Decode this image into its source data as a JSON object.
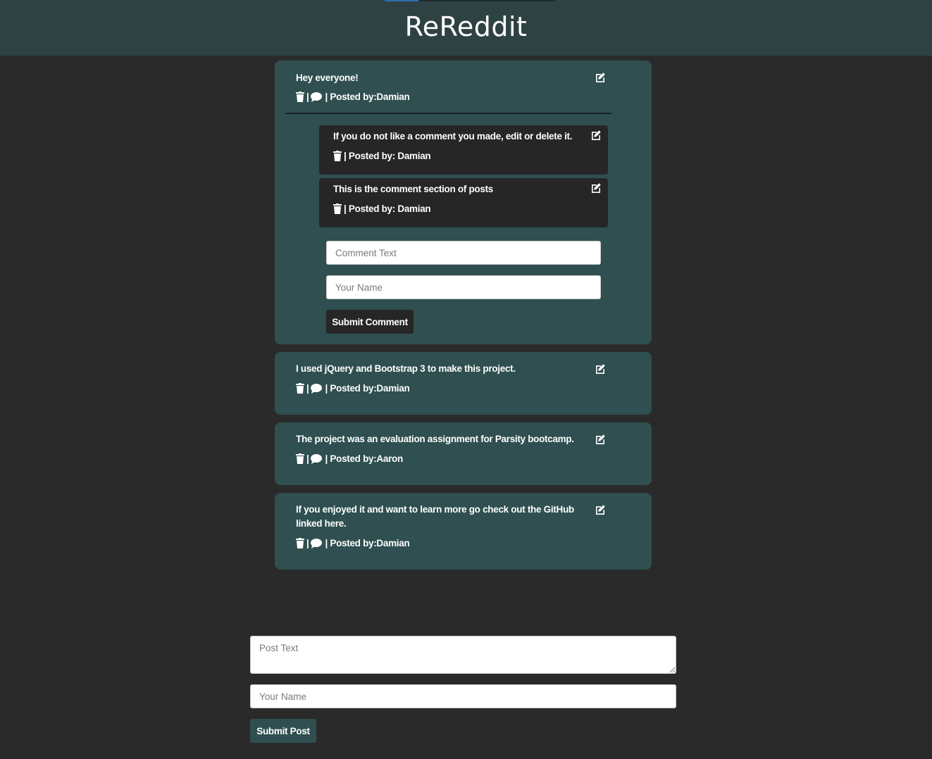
{
  "app": {
    "title": "ReReddit"
  },
  "posts": [
    {
      "text": "Hey everyone!",
      "separator": "|",
      "posted_by": "| Posted by:Damian"
    },
    {
      "text": "I used jQuery and Bootstrap 3 to make this project.",
      "separator": "|",
      "posted_by": "| Posted by:Damian"
    },
    {
      "text": "The project was an evaluation assignment for Parsity bootcamp.",
      "separator": "|",
      "posted_by": "| Posted by:Aaron"
    },
    {
      "text": "If you enjoyed it and want to learn more go check out the GitHub linked here.",
      "separator": "|",
      "posted_by": "| Posted by:Damian"
    }
  ],
  "comments": [
    {
      "text": "If you do not like a comment you made, edit or delete it.",
      "posted_by": "| Posted by: Damian"
    },
    {
      "text": "This is the comment section of posts",
      "posted_by": "| Posted by: Damian"
    }
  ],
  "comment_form": {
    "text_placeholder": "Comment Text",
    "name_placeholder": "Your Name",
    "submit_label": "Submit Comment"
  },
  "post_form": {
    "text_placeholder": "Post Text",
    "name_placeholder": "Your Name",
    "submit_label": "Submit Post"
  },
  "colors": {
    "background": "#2a2a2a",
    "header": "#2f4243",
    "post_card": "#2f4f50",
    "comment_card": "#262626"
  },
  "icons": {
    "edit": "edit-icon",
    "delete": "trash-icon",
    "comments": "comment-bubble-icon"
  }
}
